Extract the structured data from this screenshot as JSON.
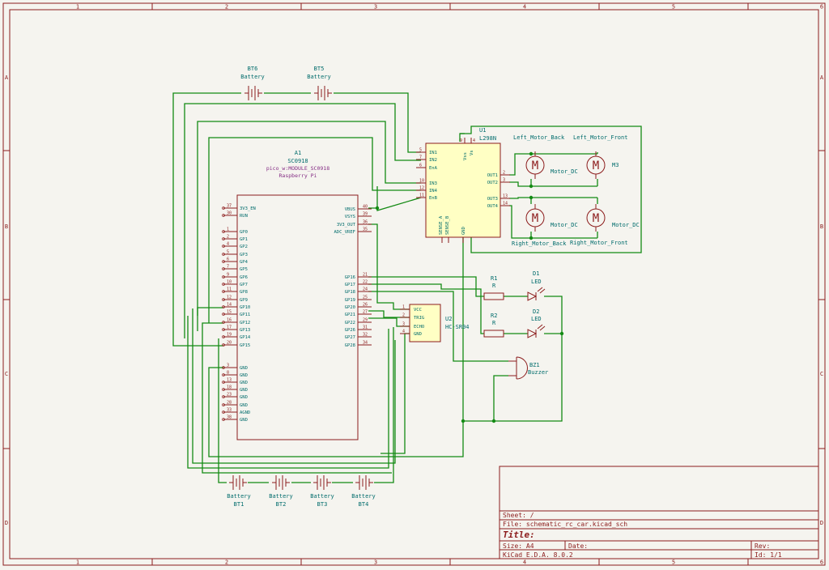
{
  "grid": {
    "columns": [
      "1",
      "2",
      "3",
      "4",
      "5",
      "6"
    ],
    "rows": [
      "A",
      "B",
      "C",
      "D"
    ]
  },
  "title_block": {
    "sheet": "Sheet: /",
    "file": "File: schematic_rc_car.kicad_sch",
    "title": "Title:",
    "size": "Size: A4",
    "date": "Date:",
    "rev": "Rev:",
    "app": "KiCad E.D.A. 8.0.2",
    "id": "Id: 1/1"
  },
  "pico": {
    "ref": "A1",
    "value": "SC0918",
    "footprint": "pico_w:MODULE_SC0918",
    "maker": "Raspberry Pi",
    "left_pins": [
      {
        "num": "37",
        "name": "3V3_EN"
      },
      {
        "num": "30",
        "name": "RUN"
      },
      {
        "num": "1",
        "name": "GP0"
      },
      {
        "num": "2",
        "name": "GP1"
      },
      {
        "num": "4",
        "name": "GP2"
      },
      {
        "num": "5",
        "name": "GP3"
      },
      {
        "num": "6",
        "name": "GP4"
      },
      {
        "num": "7",
        "name": "GP5"
      },
      {
        "num": "9",
        "name": "GP6"
      },
      {
        "num": "10",
        "name": "GP7"
      },
      {
        "num": "11",
        "name": "GP8"
      },
      {
        "num": "12",
        "name": "GP9"
      },
      {
        "num": "14",
        "name": "GP10"
      },
      {
        "num": "15",
        "name": "GP11"
      },
      {
        "num": "16",
        "name": "GP12"
      },
      {
        "num": "17",
        "name": "GP13"
      },
      {
        "num": "19",
        "name": "GP14"
      },
      {
        "num": "20",
        "name": "GP15"
      },
      {
        "num": "3",
        "name": "GND"
      },
      {
        "num": "8",
        "name": "GND"
      },
      {
        "num": "13",
        "name": "GND"
      },
      {
        "num": "18",
        "name": "GND"
      },
      {
        "num": "23",
        "name": "GND"
      },
      {
        "num": "28",
        "name": "GND"
      },
      {
        "num": "33",
        "name": "AGND"
      },
      {
        "num": "38",
        "name": "GND"
      }
    ],
    "right_pins": [
      {
        "num": "40",
        "name": "VBUS"
      },
      {
        "num": "39",
        "name": "VSYS"
      },
      {
        "num": "36",
        "name": "3V3_OUT"
      },
      {
        "num": "35",
        "name": "ADC_VREF"
      },
      {
        "num": "21",
        "name": "GP16"
      },
      {
        "num": "22",
        "name": "GP17"
      },
      {
        "num": "24",
        "name": "GP18"
      },
      {
        "num": "25",
        "name": "GP19"
      },
      {
        "num": "26",
        "name": "GP20"
      },
      {
        "num": "27",
        "name": "GP21"
      },
      {
        "num": "29",
        "name": "GP22"
      },
      {
        "num": "31",
        "name": "GP26"
      },
      {
        "num": "32",
        "name": "GP27"
      },
      {
        "num": "34",
        "name": "GP28"
      }
    ]
  },
  "driver": {
    "ref": "U1",
    "value": "L298N",
    "left_pins": [
      {
        "num": "5",
        "name": "IN1"
      },
      {
        "num": "7",
        "name": "IN2"
      },
      {
        "num": "6",
        "name": "EnA"
      },
      {
        "num": "10",
        "name": "IN3"
      },
      {
        "num": "12",
        "name": "IN4"
      },
      {
        "num": "11",
        "name": "EnB"
      }
    ],
    "right_pins": [
      {
        "num": "2",
        "name": "OUT1"
      },
      {
        "num": "3",
        "name": "OUT2"
      },
      {
        "num": "13",
        "name": "OUT3"
      },
      {
        "num": "14",
        "name": "OUT4"
      }
    ],
    "top_pins": [
      {
        "num": "9",
        "name": "Vss"
      },
      {
        "num": "4",
        "name": "Vs"
      }
    ],
    "bottom_pins": [
      {
        "num": "1",
        "name": "SENSE_A"
      },
      {
        "num": "15",
        "name": "SENSE_B"
      },
      {
        "num": "8",
        "name": "GND"
      }
    ]
  },
  "sensor": {
    "ref": "U2",
    "value": "HC-SR04",
    "pins": [
      {
        "num": "1",
        "name": "VCC"
      },
      {
        "num": "2",
        "name": "TRIG"
      },
      {
        "num": "3",
        "name": "ECHO"
      },
      {
        "num": "4",
        "name": "GND"
      }
    ]
  },
  "motors": [
    {
      "label": "Left_Motor_Back",
      "ref": "",
      "value": "Motor_DC"
    },
    {
      "label": "Left_Motor_Front",
      "ref": "M3",
      "value": ""
    },
    {
      "label": "Right_Motor_Back",
      "ref": "",
      "value": "Motor_DC"
    },
    {
      "label": "Right_Motor_Front",
      "ref": "",
      "value": "Motor_DC"
    }
  ],
  "motor_glyph": "M",
  "batteries_top": [
    {
      "ref": "BT6",
      "value": "Battery"
    },
    {
      "ref": "BT5",
      "value": "Battery"
    }
  ],
  "batteries_bottom": [
    {
      "ref": "BT1",
      "value": "Battery"
    },
    {
      "ref": "BT2",
      "value": "Battery"
    },
    {
      "ref": "BT3",
      "value": "Battery"
    },
    {
      "ref": "BT4",
      "value": "Battery"
    }
  ],
  "resistors": [
    {
      "ref": "R1",
      "value": "R"
    },
    {
      "ref": "R2",
      "value": "R"
    }
  ],
  "leds": [
    {
      "ref": "D1",
      "value": "LED"
    },
    {
      "ref": "D2",
      "value": "LED"
    }
  ],
  "buzzer": {
    "ref": "BZ1",
    "value": "Buzzer"
  },
  "colors": {
    "frame": "#8c1c1c",
    "wire": "#138a13",
    "ref_text": "#006c6c",
    "ic_fill": "#ffffc4",
    "pico_text": "#842c84",
    "background": "#f5f4ef"
  }
}
